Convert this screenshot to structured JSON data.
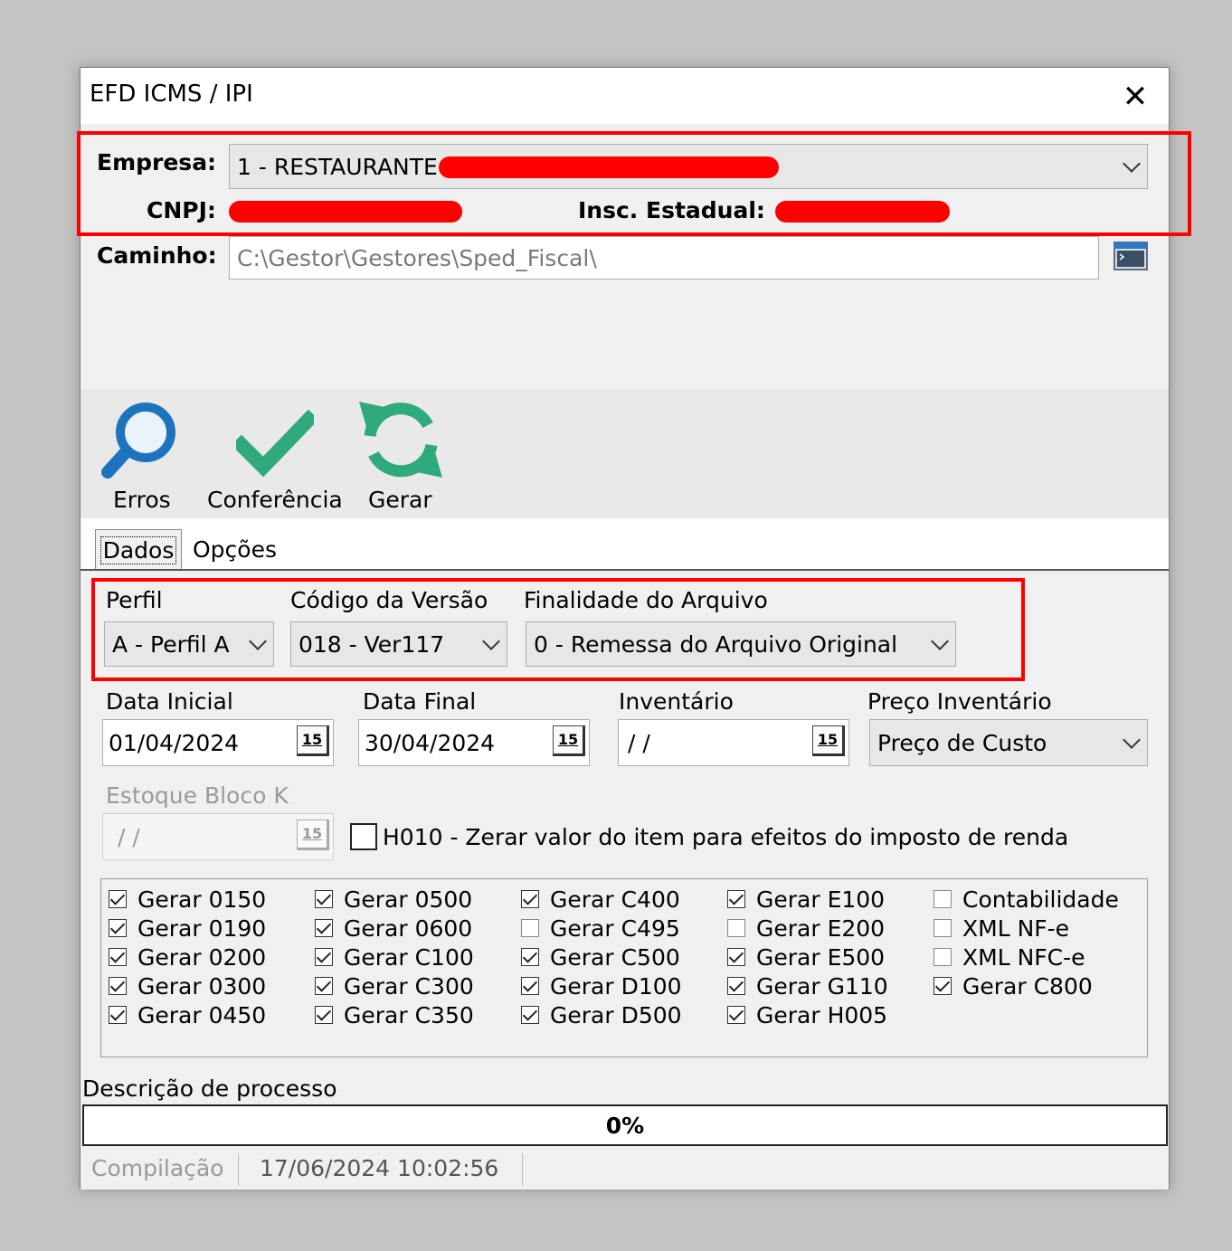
{
  "window": {
    "title": "EFD ICMS / IPI",
    "close_glyph": "✕"
  },
  "company": {
    "empresa_label": "Empresa:",
    "empresa_value": "1 - RESTAURANTE",
    "cnpj_label": "CNPJ:",
    "insc_label": "Insc. Estadual:",
    "caminho_label": "Caminho:",
    "caminho_value": "C:\\Gestor\\Gestores\\Sped_Fiscal\\"
  },
  "toolbar": {
    "items": [
      {
        "label": "Erros",
        "icon": "magnifier-icon"
      },
      {
        "label": "Conferência",
        "icon": "checkmark-icon"
      },
      {
        "label": "Gerar",
        "icon": "refresh-icon"
      }
    ]
  },
  "tabs": [
    {
      "label": "Dados",
      "active": true
    },
    {
      "label": "Opções",
      "active": false
    }
  ],
  "form": {
    "perfil_label": "Perfil",
    "perfil_value": "A - Perfil A",
    "versao_label": "Código da Versão",
    "versao_value": "018 - Ver117",
    "finalidade_label": "Finalidade do Arquivo",
    "finalidade_value": "0 - Remessa do Arquivo Original",
    "data_inicial_label": "Data Inicial",
    "data_inicial_value": "01/04/2024",
    "data_final_label": "Data Final",
    "data_final_value": "30/04/2024",
    "inventario_label": "Inventário",
    "inventario_value": " / /",
    "preco_label": "Preço Inventário",
    "preco_value": "Preço de Custo",
    "estoque_label": "Estoque Bloco K",
    "estoque_value": " / /",
    "calendar_glyph": "15",
    "h010_label": "H010 - Zerar valor do item para efeitos do imposto de renda",
    "h010_checked": false
  },
  "checkbox_columns": [
    [
      {
        "label": "Gerar 0150",
        "checked": true
      },
      {
        "label": "Gerar 0190",
        "checked": true
      },
      {
        "label": "Gerar 0200",
        "checked": true
      },
      {
        "label": "Gerar 0300",
        "checked": true
      },
      {
        "label": "Gerar 0450",
        "checked": true
      }
    ],
    [
      {
        "label": "Gerar 0500",
        "checked": true
      },
      {
        "label": "Gerar 0600",
        "checked": true
      },
      {
        "label": "Gerar C100",
        "checked": true
      },
      {
        "label": "Gerar C300",
        "checked": true
      },
      {
        "label": "Gerar C350",
        "checked": true
      }
    ],
    [
      {
        "label": "Gerar C400",
        "checked": true
      },
      {
        "label": "Gerar C495",
        "checked": false
      },
      {
        "label": "Gerar C500",
        "checked": true
      },
      {
        "label": "Gerar D100",
        "checked": true
      },
      {
        "label": "Gerar D500",
        "checked": true
      }
    ],
    [
      {
        "label": "Gerar E100",
        "checked": true
      },
      {
        "label": "Gerar E200",
        "checked": false
      },
      {
        "label": "Gerar E500",
        "checked": true
      },
      {
        "label": "Gerar G110",
        "checked": true
      },
      {
        "label": "Gerar H005",
        "checked": true
      }
    ],
    [
      {
        "label": "Contabilidade",
        "checked": false
      },
      {
        "label": "XML NF-e",
        "checked": false
      },
      {
        "label": "XML NFC-e",
        "checked": false
      },
      {
        "label": "Gerar C800",
        "checked": true
      }
    ]
  ],
  "process": {
    "label": "Descrição de processo",
    "progress_text": "0%",
    "progress": 0
  },
  "status": {
    "compilacao_label": "Compilação",
    "timestamp": "17/06/2024 10:02:56"
  },
  "colors": {
    "highlight": "#ff0000",
    "icon_blue": "#1e73be",
    "icon_green": "#2eaa7c"
  }
}
